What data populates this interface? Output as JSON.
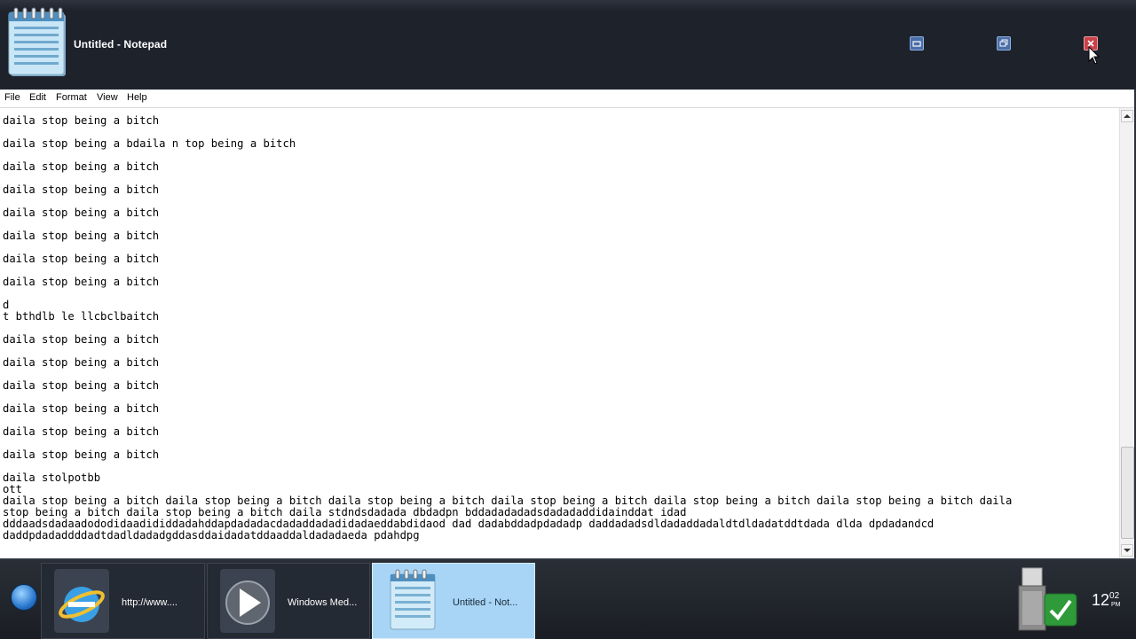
{
  "window": {
    "title": "Untitled - Notepad",
    "icon": "notepad-icon",
    "controls": [
      "minimize-icon",
      "maximize-icon",
      "close-icon"
    ]
  },
  "menu": {
    "items": [
      "File",
      "Edit",
      "Format",
      "View",
      "Help"
    ]
  },
  "editor": {
    "lines": [
      "daila stop being a bitch",
      "",
      "daila stop being a bdaila n top being a bitch",
      "",
      "daila stop being a bitch",
      "",
      "daila stop being a bitch",
      "",
      "daila stop being a bitch",
      "",
      "daila stop being a bitch",
      "",
      "daila stop being a bitch",
      "",
      "daila stop being a bitch",
      "",
      "d",
      "t bthdlb le llcbclbaitch",
      "",
      "daila stop being a bitch",
      "",
      "daila stop being a bitch",
      "",
      "daila stop being a bitch",
      "",
      "daila stop being a bitch",
      "",
      "daila stop being a bitch",
      "",
      "daila stop being a bitch",
      "",
      "daila stolpotbb",
      "ott",
      "daila stop being a bitch daila stop being a bitch daila stop being a bitch daila stop being a bitch daila stop being a bitch daila stop being a bitch daila",
      "stop being a bitch daila stop being a bitch daila stdndsdadada dbdadpn bddadadadadsdadadaddidainddat idad",
      "dddaadsdadaadododidaadididdadahddapdadadacdadaddadadidadaeddabdidaod dad dadabddadpdadadp daddadadsdldadaddadaldtdldadatddtdada dlda dpdadandcd",
      "daddpdadaddddadtdadldadadgddasddaidadatddaaddaldadadaeda pdahdpg"
    ]
  },
  "scrollbar": {
    "up_icon": "scroll-up-arrow-icon",
    "down_icon": "scroll-down-arrow-icon",
    "position": 0.94
  },
  "taskbar": {
    "start_icon": "windows-start-orb-icon",
    "tasks": [
      {
        "label": "http://www....",
        "icon": "internet-explorer-icon"
      },
      {
        "label": "Windows Med...",
        "icon": "windows-media-player-icon"
      },
      {
        "label": "Untitled - Not...",
        "icon": "notepad-icon",
        "active": true
      }
    ],
    "tray": {
      "icons": [
        "usb-device-icon",
        "security-check-icon"
      ],
      "clock": {
        "hour": "12",
        "minute": "02",
        "ampm": "PM"
      }
    }
  },
  "colors": {
    "titlebar": "#1d222b",
    "taskbar_active": "#a8d5f6",
    "close_button": "#c8424a"
  }
}
